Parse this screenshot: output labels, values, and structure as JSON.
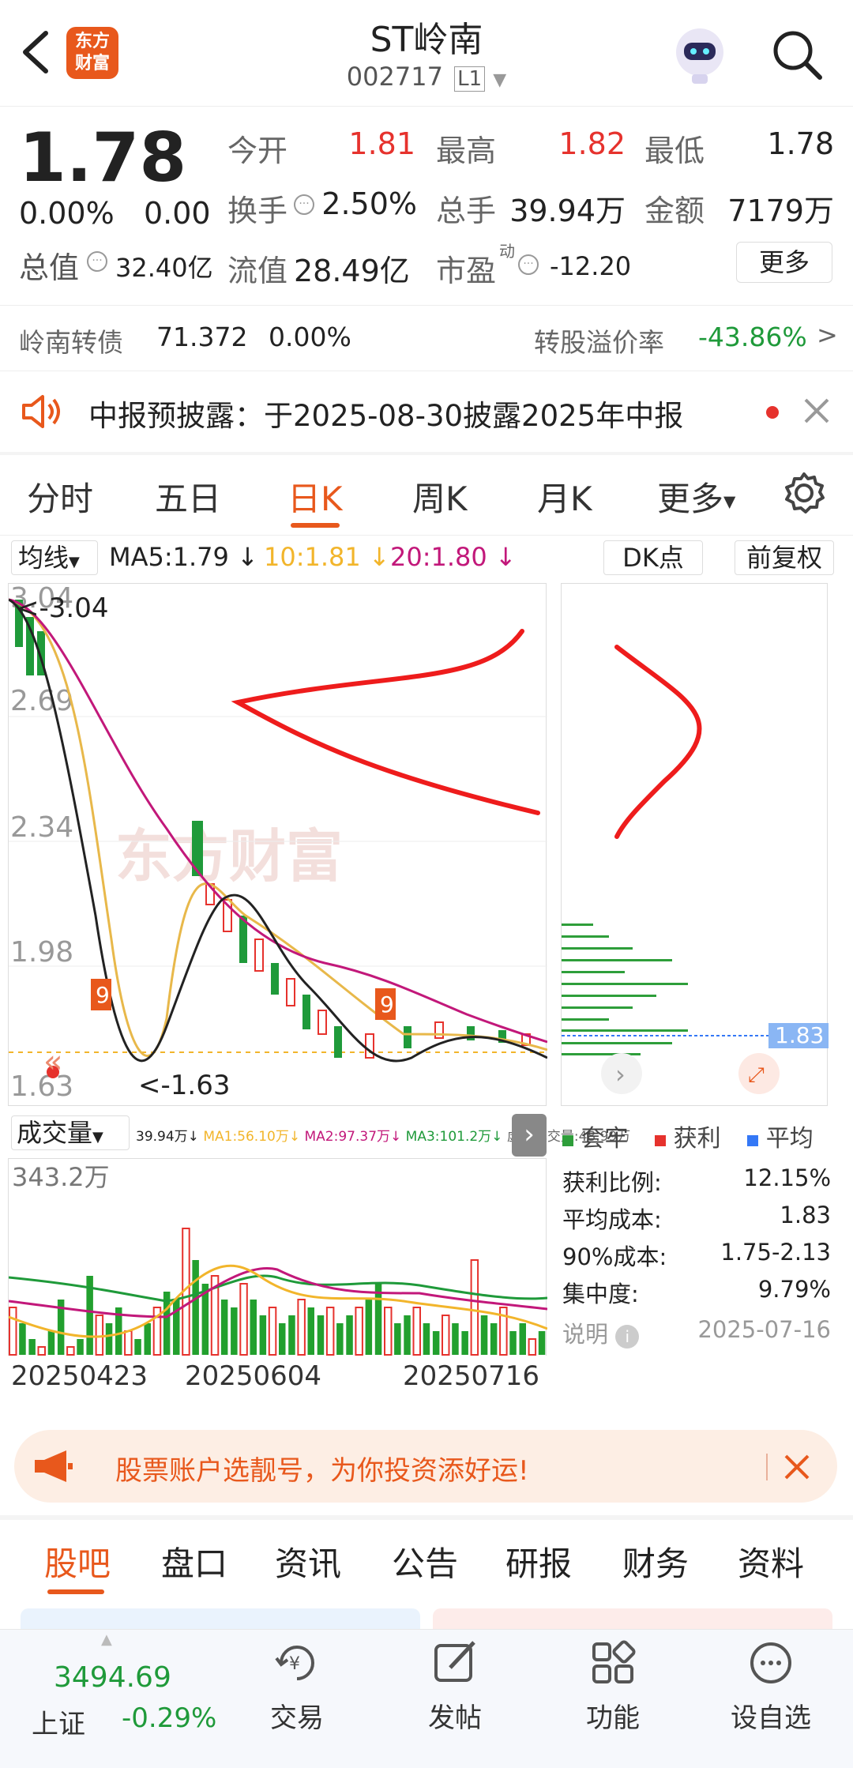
{
  "header": {
    "logo_text_1": "东方",
    "logo_text_2": "财富",
    "title": "ST岭南",
    "code": "002717",
    "level": "L1"
  },
  "quote": {
    "price": "1.78",
    "change_pct": "0.00%",
    "change": "0.00",
    "open_label": "今开",
    "open": "1.81",
    "high_label": "最高",
    "high": "1.82",
    "low_label": "最低",
    "low": "1.78",
    "turnover_label": "换手",
    "turnover": "2.50%",
    "volume_label": "总手",
    "volume": "39.94万",
    "amount_label": "金额",
    "amount": "7179万",
    "mktcap_label": "总值",
    "mktcap": "32.40亿",
    "float_label": "流值",
    "float": "28.49亿",
    "pe_label": "市盈",
    "pe_sup": "动",
    "pe": "-12.20",
    "more_label": "更多"
  },
  "bond": {
    "name": "岭南转债",
    "price": "71.372",
    "pct": "0.00%",
    "premium_label": "转股溢价率",
    "premium": "-43.86%"
  },
  "notice": {
    "text": "中报预披露：于2025-08-30披露2025年中报"
  },
  "tabs": [
    "分时",
    "五日",
    "日K",
    "周K",
    "月K",
    "更多"
  ],
  "ma": {
    "type_label": "均线",
    "ma5": "MA5:1.79",
    "ma10": "10:1.81",
    "ma20": "20:1.80",
    "dk_label": "DK点",
    "fq_label": "前复权"
  },
  "kline": {
    "y_labels": [
      "3.04",
      "2.69",
      "2.34",
      "1.98",
      "1.63"
    ],
    "max_label": "3.04",
    "min_label": "1.63",
    "watermark": "东方财富",
    "nine_labels": [
      "9",
      "9"
    ]
  },
  "chips": {
    "price_tag": "1.83",
    "legend_trapped": "套牢",
    "legend_profit": "获利",
    "legend_avg": "平均",
    "rows": [
      {
        "label": "获利比例:",
        "value": "12.15%"
      },
      {
        "label": "平均成本:",
        "value": "1.83"
      },
      {
        "label": "90%成本:",
        "value": "1.75-2.13"
      },
      {
        "label": "集中度:",
        "value": "9.79%"
      }
    ],
    "note_label": "说明",
    "date": "2025-07-16"
  },
  "volume": {
    "label": "成交量",
    "v0": "39.94万↓",
    "ma1": "MA1:56.10万↓",
    "ma2": "MA2:97.37万↓",
    "ma3": "MA3:101.2万↓",
    "virtual": "虚拟成交量:48.99万",
    "max_label": "343.2万",
    "dates": [
      "20250423",
      "20250604",
      "20250716"
    ]
  },
  "ad": {
    "text": "股票账户选靓号，为你投资添好运!"
  },
  "subtabs": [
    "股吧",
    "盘口",
    "资讯",
    "公告",
    "研报",
    "财务",
    "资料"
  ],
  "bottom": {
    "index_value": "3494.69",
    "index_name": "上证",
    "index_pct": "-0.29%",
    "items": [
      "交易",
      "发帖",
      "功能",
      "设自选"
    ]
  },
  "colors": {
    "up": "#e6322d",
    "down": "#1f9a3a",
    "brand": "#e8581c",
    "ma10": "#f2b52b",
    "ma20": "#c2187a"
  }
}
